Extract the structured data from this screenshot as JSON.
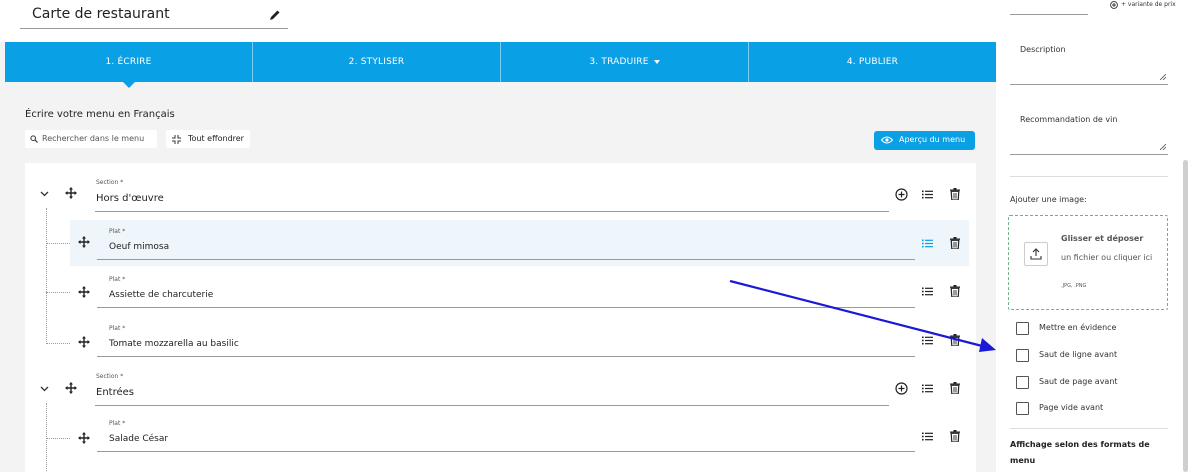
{
  "header": {
    "menu_title": "Carte de restaurant"
  },
  "tabs": [
    {
      "label": "1. ÉCRIRE"
    },
    {
      "label": "2. STYLISER"
    },
    {
      "label": "3. TRADUIRE"
    },
    {
      "label": "4. PUBLIER"
    }
  ],
  "editor": {
    "heading": "Écrire votre menu en Français",
    "search_placeholder": "Rechercher dans le menu",
    "collapse_label": "Tout effondrer",
    "preview_label": "Aperçu du menu"
  },
  "sections": [
    {
      "label": "Section *",
      "name": "Hors d'œuvre",
      "items": [
        {
          "label": "Plat *",
          "name": "Oeuf mimosa"
        },
        {
          "label": "Plat *",
          "name": "Assiette de charcuterie"
        },
        {
          "label": "Plat *",
          "name": "Tomate mozzarella au basilic"
        }
      ]
    },
    {
      "label": "Section *",
      "name": "Entrées",
      "items": [
        {
          "label": "Plat *",
          "name": "Salade César"
        }
      ]
    }
  ],
  "sidebar": {
    "variant_label": "+ variante de prix",
    "description_label": "Description",
    "wine_label": "Recommandation de vin",
    "image_label": "Ajouter une image:",
    "drop_title": "Glisser et déposer",
    "drop_sub": "un fichier ou cliquer ici",
    "drop_formats": ".JPG, .PNG",
    "checkboxes": [
      {
        "label": "Mettre en évidence",
        "checked": false
      },
      {
        "label": "Saut de ligne avant",
        "checked": false
      },
      {
        "label": "Saut de page avant",
        "checked": false
      },
      {
        "label": "Page vide avant",
        "checked": false
      }
    ],
    "formats_heading": "Affichage selon des formats de menu"
  },
  "colors": {
    "accent": "#0aa0e5",
    "annotation_arrow": "#1a1ad6"
  }
}
